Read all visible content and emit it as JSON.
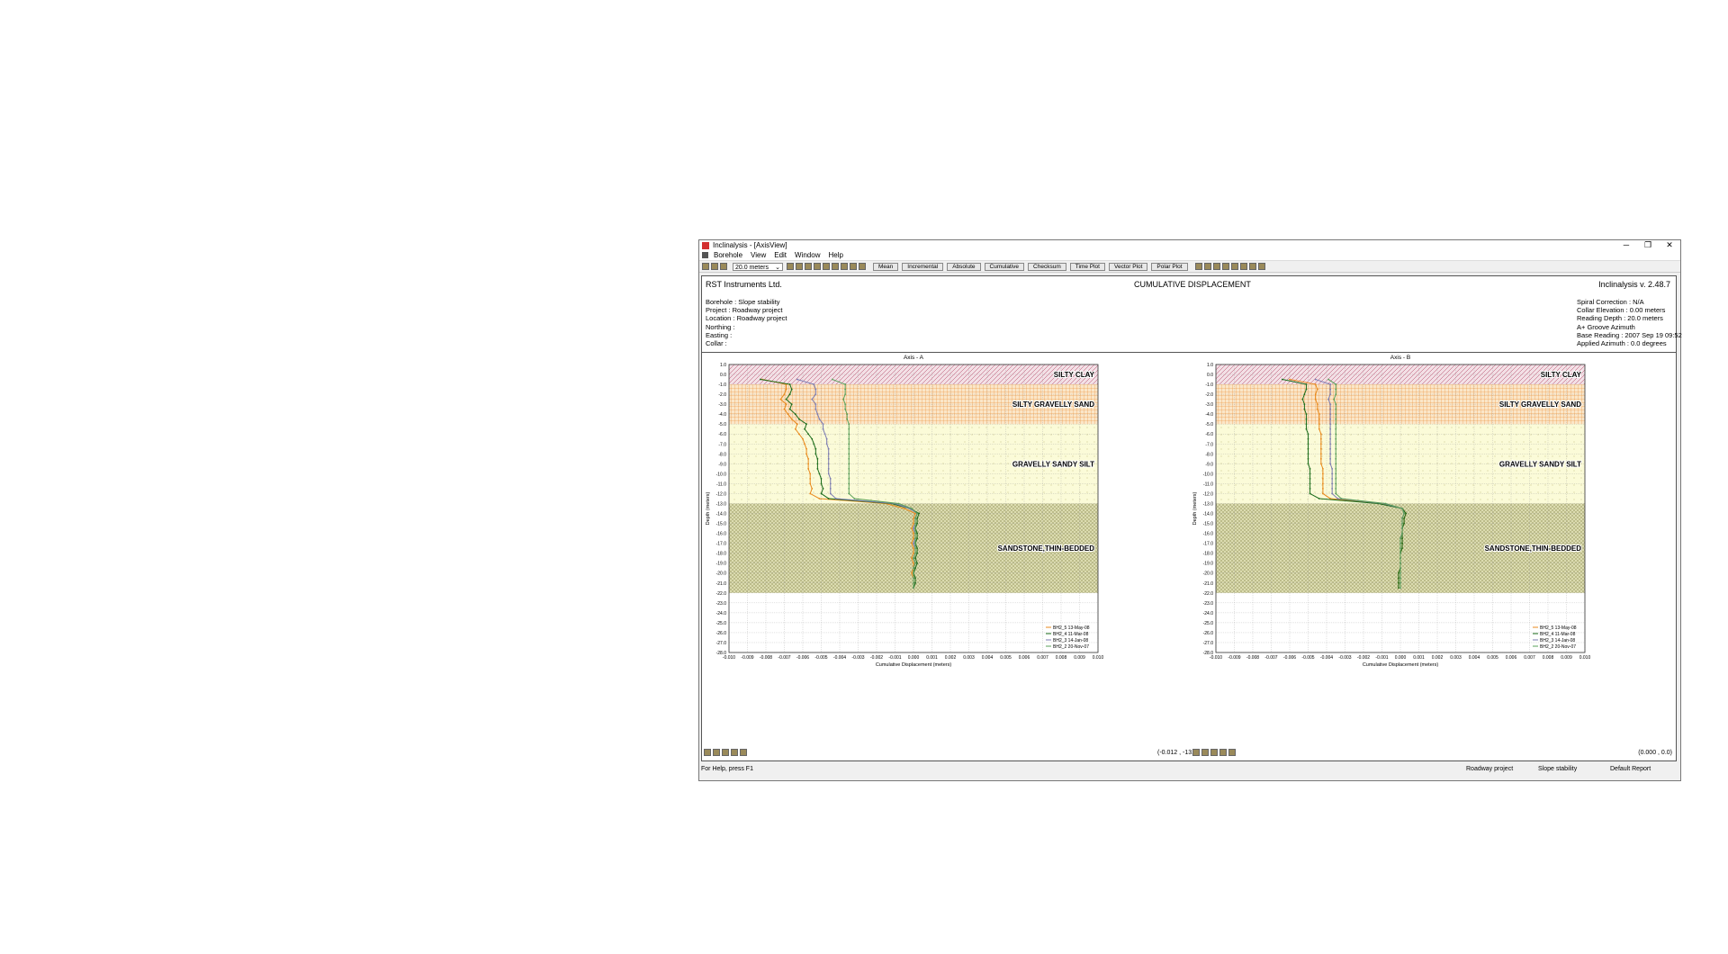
{
  "window": {
    "title": "Inclinalysis - [AxisView]",
    "controls": {
      "minimize": "─",
      "restore": "❐",
      "close": "✕"
    }
  },
  "menu": [
    "Borehole",
    "View",
    "Edit",
    "Window",
    "Help"
  ],
  "toolbar": {
    "depth_select": "20.0 meters",
    "buttons": [
      "Mean",
      "Incremental",
      "Absolute",
      "Cumulative",
      "Checksum",
      "Time Plot",
      "Vector Plot",
      "Polar Plot"
    ]
  },
  "header": {
    "company": "RST Instruments Ltd.",
    "title": "CUMULATIVE DISPLACEMENT",
    "version": "Inclinalysis v. 2.48.7"
  },
  "left_info": [
    "Borehole : Slope stability",
    "Project : Roadway project",
    "Location : Roadway project",
    "Northing :",
    "Easting :",
    "Collar :"
  ],
  "right_info": [
    "Spiral Correction : N/A",
    "Collar Elevation : 0.00 meters",
    "Reading Depth : 20.0 meters",
    "A+ Groove Azimuth",
    "Base Reading : 2007 Sep 19 09:52",
    "Applied Azimuth : 0.0 degrees"
  ],
  "coord_readouts": {
    "a": "(-0.012 , -13.0)",
    "b": "(0.000 , 0.0)"
  },
  "statusbar": {
    "help": "For Help, press F1",
    "project": "Roadway project",
    "borehole": "Slope stability",
    "report": "Default Report"
  },
  "colors": {
    "series": [
      "#e8891c",
      "#1a6b1a",
      "#7a7ab0",
      "#5aa05a"
    ],
    "silty_clay": "#c9a0b0",
    "silty_gravelly_sand": "#f0c890",
    "gravelly_sandy_silt": "#fafad0",
    "sandstone": "#d4d4a8"
  },
  "chart_data": [
    {
      "type": "line",
      "title": "Axis - A",
      "xlabel": "Cumulative Displacement (meters)",
      "ylabel": "Depth (meters)",
      "xlim": [
        -0.01,
        0.01
      ],
      "ylim": [
        -28.0,
        1.0
      ],
      "xticks": [
        "-0.010",
        "-0.009",
        "-0.008",
        "-0.007",
        "-0.006",
        "-0.005",
        "-0.004",
        "-0.003",
        "-0.002",
        "-0.001",
        "0.000",
        "0.001",
        "0.002",
        "0.003",
        "0.004",
        "0.005",
        "0.006",
        "0.007",
        "0.008",
        "0.009",
        "0.010"
      ],
      "yticks": [
        "1.0",
        "0.0",
        "-1.0",
        "-2.0",
        "-3.0",
        "-4.0",
        "-5.0",
        "-6.0",
        "-7.0",
        "-8.0",
        "-9.0",
        "-10.0",
        "-11.0",
        "-12.0",
        "-13.0",
        "-14.0",
        "-15.0",
        "-16.0",
        "-17.0",
        "-18.0",
        "-19.0",
        "-20.0",
        "-21.0",
        "-22.0",
        "-23.0",
        "-24.0",
        "-25.0",
        "-26.0",
        "-27.0",
        "-28.0"
      ],
      "layers": [
        {
          "name": "SILTY CLAY",
          "top": 1.0,
          "bottom": -1.0
        },
        {
          "name": "SILTY GRAVELLY SAND",
          "top": -1.0,
          "bottom": -5.0
        },
        {
          "name": "GRAVELLY SANDY SILT",
          "top": -5.0,
          "bottom": -13.0
        },
        {
          "name": "SANDSTONE,THIN-BEDDED",
          "top": -13.0,
          "bottom": -22.0
        }
      ],
      "depths": [
        -0.5,
        -1.0,
        -1.5,
        -2.0,
        -2.5,
        -3.0,
        -3.5,
        -4.0,
        -4.5,
        -5.0,
        -5.5,
        -6.0,
        -6.5,
        -7.0,
        -7.5,
        -8.0,
        -8.5,
        -9.0,
        -9.5,
        -10.0,
        -10.5,
        -11.0,
        -11.5,
        -12.0,
        -12.5,
        -13.0,
        -13.5,
        -14.0,
        -14.5,
        -15.0,
        -15.5,
        -16.0,
        -16.5,
        -17.0,
        -17.5,
        -18.0,
        -18.5,
        -19.0,
        -19.5,
        -20.0,
        -20.5,
        -21.0,
        -21.5
      ],
      "series": [
        {
          "name": "BH2_5 13-May-08",
          "x": [
            -0.0082,
            -0.0069,
            -0.0069,
            -0.007,
            -0.0072,
            -0.0069,
            -0.007,
            -0.0068,
            -0.0066,
            -0.0063,
            -0.0064,
            -0.0062,
            -0.006,
            -0.0059,
            -0.0058,
            -0.0058,
            -0.0057,
            -0.0057,
            -0.0057,
            -0.0056,
            -0.0056,
            -0.0056,
            -0.0055,
            -0.0056,
            -0.0051,
            -0.0015,
            -0.0005,
            0.0001,
            0.0,
            0.0,
            -0.0001,
            0.0,
            0.0,
            -0.0001,
            0.0,
            0.0,
            -0.0001,
            0.0,
            0.0,
            -0.0001,
            0.0,
            0.0,
            0.0
          ]
        },
        {
          "name": "BH2_4 11-Mar-08",
          "x": [
            -0.0083,
            -0.0067,
            -0.0066,
            -0.0067,
            -0.0069,
            -0.0066,
            -0.0067,
            -0.0064,
            -0.0062,
            -0.0058,
            -0.0059,
            -0.0057,
            -0.0055,
            -0.0054,
            -0.0053,
            -0.0053,
            -0.0052,
            -0.0052,
            -0.0052,
            -0.0051,
            -0.005,
            -0.005,
            -0.0049,
            -0.005,
            -0.0046,
            -0.0012,
            -0.0002,
            0.0003,
            0.0002,
            0.0002,
            0.0001,
            0.0002,
            0.0002,
            0.0001,
            0.0002,
            0.0002,
            0.0001,
            0.0002,
            0.0001,
            0.0,
            0.0001,
            0.0001,
            0.0
          ]
        },
        {
          "name": "BH2_3 14-Jan-08",
          "x": [
            -0.0063,
            -0.0054,
            -0.0053,
            -0.0053,
            -0.0055,
            -0.0053,
            -0.0053,
            -0.0052,
            -0.0051,
            -0.0049,
            -0.0049,
            -0.0048,
            -0.0047,
            -0.0047,
            -0.0046,
            -0.0046,
            -0.0046,
            -0.0046,
            -0.0046,
            -0.0046,
            -0.0045,
            -0.0045,
            -0.0045,
            -0.0045,
            -0.0042,
            -0.001,
            -0.0002,
            0.0002,
            0.0001,
            0.0001,
            0.0,
            0.0001,
            0.0001,
            0.0,
            0.0001,
            0.0001,
            0.0,
            0.0001,
            0.0,
            0.0,
            0.0,
            0.0,
            0.0
          ]
        },
        {
          "name": "BH2_2 20-Nov-07",
          "x": [
            -0.0044,
            -0.0037,
            -0.0037,
            -0.0037,
            -0.0038,
            -0.0037,
            -0.0037,
            -0.0036,
            -0.0036,
            -0.0035,
            -0.0035,
            -0.0035,
            -0.0035,
            -0.0035,
            -0.0035,
            -0.0035,
            -0.0035,
            -0.0035,
            -0.0035,
            -0.0035,
            -0.0035,
            -0.0035,
            -0.0035,
            -0.0035,
            -0.0032,
            -0.0008,
            -0.0001,
            0.0002,
            0.0001,
            0.0001,
            0.0001,
            0.0001,
            0.0001,
            0.0001,
            0.0001,
            0.0001,
            0.0,
            0.0001,
            0.0,
            0.0,
            0.0,
            0.0,
            0.0
          ]
        }
      ],
      "legend_position": "bottom-right"
    },
    {
      "type": "line",
      "title": "Axis - B",
      "xlabel": "Cumulative Displacement (meters)",
      "ylabel": "Depth (meters)",
      "xlim": [
        -0.01,
        0.01
      ],
      "ylim": [
        -28.0,
        1.0
      ],
      "xticks": [
        "-0.010",
        "-0.009",
        "-0.008",
        "-0.007",
        "-0.006",
        "-0.005",
        "-0.004",
        "-0.003",
        "-0.002",
        "-0.001",
        "0.000",
        "0.001",
        "0.002",
        "0.003",
        "0.004",
        "0.005",
        "0.006",
        "0.007",
        "0.008",
        "0.009",
        "0.010"
      ],
      "yticks": [
        "1.0",
        "0.0",
        "-1.0",
        "-2.0",
        "-3.0",
        "-4.0",
        "-5.0",
        "-6.0",
        "-7.0",
        "-8.0",
        "-9.0",
        "-10.0",
        "-11.0",
        "-12.0",
        "-13.0",
        "-14.0",
        "-15.0",
        "-16.0",
        "-17.0",
        "-18.0",
        "-19.0",
        "-20.0",
        "-21.0",
        "-22.0",
        "-23.0",
        "-24.0",
        "-25.0",
        "-26.0",
        "-27.0",
        "-28.0"
      ],
      "layers": [
        {
          "name": "SILTY CLAY",
          "top": 1.0,
          "bottom": -1.0
        },
        {
          "name": "SILTY GRAVELLY SAND",
          "top": -1.0,
          "bottom": -5.0
        },
        {
          "name": "GRAVELLY SANDY SILT",
          "top": -5.0,
          "bottom": -13.0
        },
        {
          "name": "SANDSTONE,THIN-BEDDED",
          "top": -13.0,
          "bottom": -22.0
        }
      ],
      "depths": [
        -0.5,
        -1.0,
        -1.5,
        -2.0,
        -2.5,
        -3.0,
        -3.5,
        -4.0,
        -4.5,
        -5.0,
        -5.5,
        -6.0,
        -6.5,
        -7.0,
        -7.5,
        -8.0,
        -8.5,
        -9.0,
        -9.5,
        -10.0,
        -10.5,
        -11.0,
        -11.5,
        -12.0,
        -12.5,
        -13.0,
        -13.5,
        -14.0,
        -14.5,
        -15.0,
        -15.5,
        -16.0,
        -16.5,
        -17.0,
        -17.5,
        -18.0,
        -18.5,
        -19.0,
        -19.5,
        -20.0,
        -20.5,
        -21.0,
        -21.5
      ],
      "series": [
        {
          "name": "BH2_5 13-May-08",
          "x": [
            -0.006,
            -0.0046,
            -0.0045,
            -0.0046,
            -0.0046,
            -0.0045,
            -0.0045,
            -0.0044,
            -0.0044,
            -0.0044,
            -0.0044,
            -0.0043,
            -0.0043,
            -0.0043,
            -0.0043,
            -0.0043,
            -0.0043,
            -0.0043,
            -0.0042,
            -0.0042,
            -0.0042,
            -0.0042,
            -0.0042,
            -0.0042,
            -0.0038,
            -0.001,
            0.0001,
            0.0003,
            0.0002,
            0.0002,
            0.0001,
            0.0001,
            0.0001,
            0.0001,
            0.0001,
            0.0,
            0.0,
            0.0,
            0.0,
            -0.0001,
            -0.0001,
            -0.0001,
            -0.0001
          ]
        },
        {
          "name": "BH2_4 11-Mar-08",
          "x": [
            -0.0064,
            -0.0051,
            -0.0051,
            -0.0052,
            -0.0053,
            -0.0052,
            -0.0052,
            -0.0051,
            -0.0051,
            -0.0051,
            -0.0051,
            -0.005,
            -0.005,
            -0.005,
            -0.005,
            -0.005,
            -0.005,
            -0.005,
            -0.0049,
            -0.0049,
            -0.0049,
            -0.0049,
            -0.0049,
            -0.0049,
            -0.0044,
            -0.0012,
            0.0001,
            0.0003,
            0.0002,
            0.0002,
            0.0001,
            0.0001,
            0.0001,
            0.0001,
            0.0001,
            0.0,
            0.0,
            0.0,
            0.0,
            -0.0001,
            -0.0001,
            -0.0001,
            -0.0001
          ]
        },
        {
          "name": "BH2_3 14-Jan-08",
          "x": [
            -0.0046,
            -0.0038,
            -0.0038,
            -0.0038,
            -0.0039,
            -0.0038,
            -0.0038,
            -0.0038,
            -0.0038,
            -0.0038,
            -0.0038,
            -0.0038,
            -0.0038,
            -0.0038,
            -0.0038,
            -0.0038,
            -0.0038,
            -0.0038,
            -0.0037,
            -0.0037,
            -0.0037,
            -0.0037,
            -0.0037,
            -0.0037,
            -0.0034,
            -0.0009,
            0.0001,
            0.0002,
            0.0001,
            0.0001,
            0.0001,
            0.0001,
            0.0,
            0.0,
            0.0,
            0.0,
            0.0,
            0.0,
            0.0,
            0.0,
            0.0,
            0.0,
            0.0
          ]
        },
        {
          "name": "BH2_2 20-Nov-07",
          "x": [
            -0.0039,
            -0.0035,
            -0.0035,
            -0.0035,
            -0.0036,
            -0.0035,
            -0.0035,
            -0.0035,
            -0.0035,
            -0.0035,
            -0.0035,
            -0.0035,
            -0.0035,
            -0.0035,
            -0.0035,
            -0.0035,
            -0.0035,
            -0.0035,
            -0.0035,
            -0.0035,
            -0.0035,
            -0.0035,
            -0.0035,
            -0.0035,
            -0.0032,
            -0.0008,
            0.0001,
            0.0002,
            0.0001,
            0.0001,
            0.0001,
            0.0001,
            0.0,
            0.0,
            0.0,
            0.0,
            0.0,
            0.0,
            0.0,
            0.0,
            0.0,
            0.0,
            0.0
          ]
        }
      ],
      "legend_position": "bottom-right"
    }
  ]
}
